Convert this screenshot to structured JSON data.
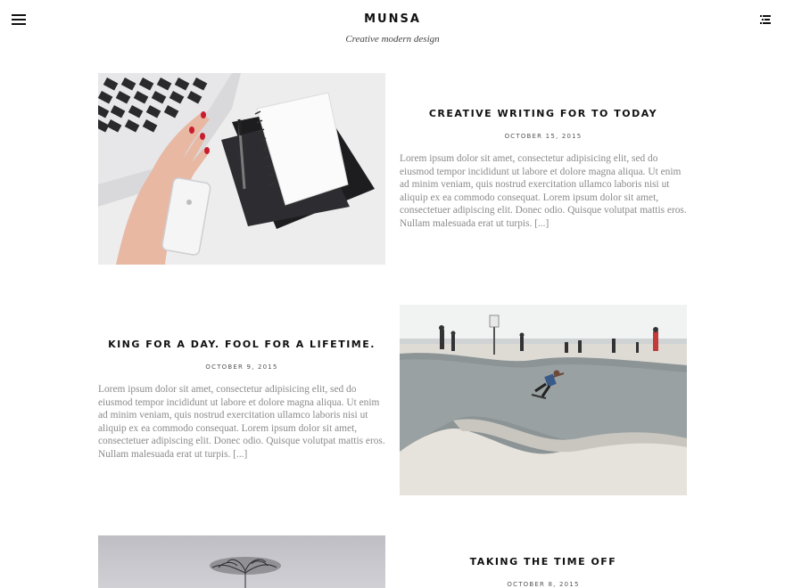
{
  "site": {
    "title": "MUNSA",
    "tagline": "Creative modern design"
  },
  "header": {
    "menu_icon": "hamburger-menu-icon",
    "list_icon": "list-view-icon"
  },
  "posts": [
    {
      "title": "CREATIVE WRITING FOR TO TODAY",
      "date": "OCTOBER 15, 2015",
      "excerpt": "Lorem ipsum dolor sit amet, consectetur adipisicing elit, sed do eiusmod tempor incididunt ut labore et dolore magna aliqua. Ut enim ad minim veniam, quis nostrud exercitation ullamco laboris nisi ut aliquip ex ea commodo consequat. Lorem ipsum dolor sit amet, consectetuer adipiscing elit. Donec odio. Quisque volutpat mattis eros. Nullam malesuada erat ut turpis. [...]",
      "image": "laptop-notebook-phone-desk-photo"
    },
    {
      "title": "KING FOR A DAY. FOOL FOR A LIFETIME.",
      "date": "OCTOBER 9, 2015",
      "excerpt": "Lorem ipsum dolor sit amet, consectetur adipisicing elit, sed do eiusmod tempor incididunt ut labore et dolore magna aliqua. Ut enim ad minim veniam, quis nostrud exercitation ullamco laboris nisi ut aliquip ex ea commodo consequat. Lorem ipsum dolor sit amet, consectetuer adipiscing elit. Donec odio. Quisque volutpat mattis eros. Nullam malesuada erat ut turpis. [...]",
      "image": "skatepark-photo"
    },
    {
      "title": "TAKING THE TIME OFF",
      "date": "OCTOBER 8, 2015",
      "image": "bare-tree-photo"
    }
  ]
}
